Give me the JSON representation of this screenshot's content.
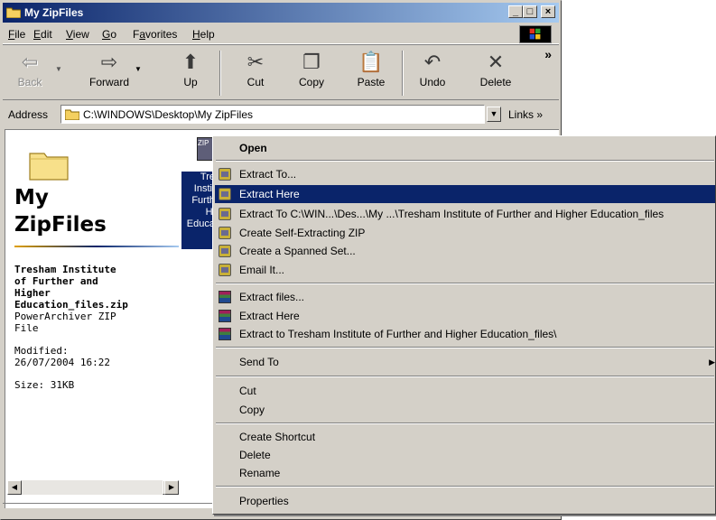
{
  "window": {
    "title": "My ZipFiles",
    "controls": [
      "_",
      "□",
      "×"
    ]
  },
  "menu": {
    "items": [
      {
        "accel": "F",
        "rest": "ile"
      },
      {
        "accel": "E",
        "rest": "dit"
      },
      {
        "accel": "V",
        "rest": "iew"
      },
      {
        "accel": "G",
        "rest": "o"
      },
      {
        "pre": "F",
        "accel": "a",
        "rest": "vorites"
      },
      {
        "accel": "H",
        "rest": "elp"
      }
    ]
  },
  "toolbar": {
    "back": "Back",
    "forward": "Forward",
    "up": "Up",
    "cut": "Cut",
    "copy": "Copy",
    "paste": "Paste",
    "undo": "Undo",
    "delete": "Delete",
    "more": "»"
  },
  "address": {
    "label": "Address",
    "value": "C:\\WINDOWS\\Desktop\\My ZipFiles",
    "links": "Links »"
  },
  "webview": {
    "title_line1": "My",
    "title_line2": "ZipFiles",
    "file_name_lines": [
      "Tresham Institute",
      "of Further and",
      "Higher",
      "Education_files.zip"
    ],
    "file_type_lines": [
      "PowerArchiver ZIP",
      "File"
    ],
    "modified_label": "Modified:",
    "modified_value": "26/07/2004 16:22",
    "size": "Size: 31KB"
  },
  "selected_file": {
    "icon_text": "ZIP",
    "label_lines": [
      "Tre",
      "Instit",
      "Furth",
      "Hi",
      "Educa"
    ]
  },
  "context_menu": {
    "open": "Open",
    "extract_to": "Extract To...",
    "extract_here": "Extract Here",
    "extract_to_path": "Extract To C:\\WIN...\\Des...\\My ...\\Tresham Institute of Further and Higher Education_files",
    "create_sfx": "Create Self-Extracting ZIP",
    "create_spanned": "Create a Spanned Set...",
    "email_it": "Email It...",
    "rar_extract_files": "Extract files...",
    "rar_extract_here": "Extract Here",
    "rar_extract_to": "Extract to Tresham Institute of Further and Higher Education_files\\",
    "send_to": "Send To",
    "cut": "Cut",
    "copy": "Copy",
    "create_shortcut": "Create Shortcut",
    "delete": "Delete",
    "rename": "Rename",
    "properties": "Properties"
  },
  "colors": {
    "titlebar_start": "#0a246a",
    "titlebar_end": "#a6caf0",
    "highlight": "#0a246a",
    "face": "#d4d0c8"
  }
}
